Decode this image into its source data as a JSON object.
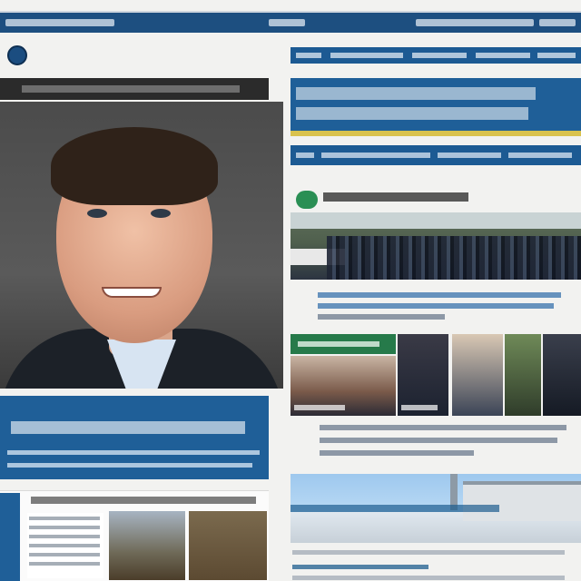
{
  "site": {
    "name": "",
    "nav": {
      "items": []
    }
  },
  "hero": {
    "kicker": "",
    "photo_alt": ""
  },
  "feature": {
    "headline": "",
    "subnav": []
  },
  "story_crowd": {
    "headline": "",
    "summary": ""
  },
  "story_left": {
    "headline": "",
    "summary": ""
  },
  "gallery": {
    "label": "",
    "captions": []
  },
  "story_bottom": {
    "headline": ""
  },
  "colors": {
    "brand": "#134a7c",
    "accent": "#d9c24d",
    "section_green": "#267a4a"
  },
  "icons": {
    "logo": "circular-logo-icon"
  }
}
